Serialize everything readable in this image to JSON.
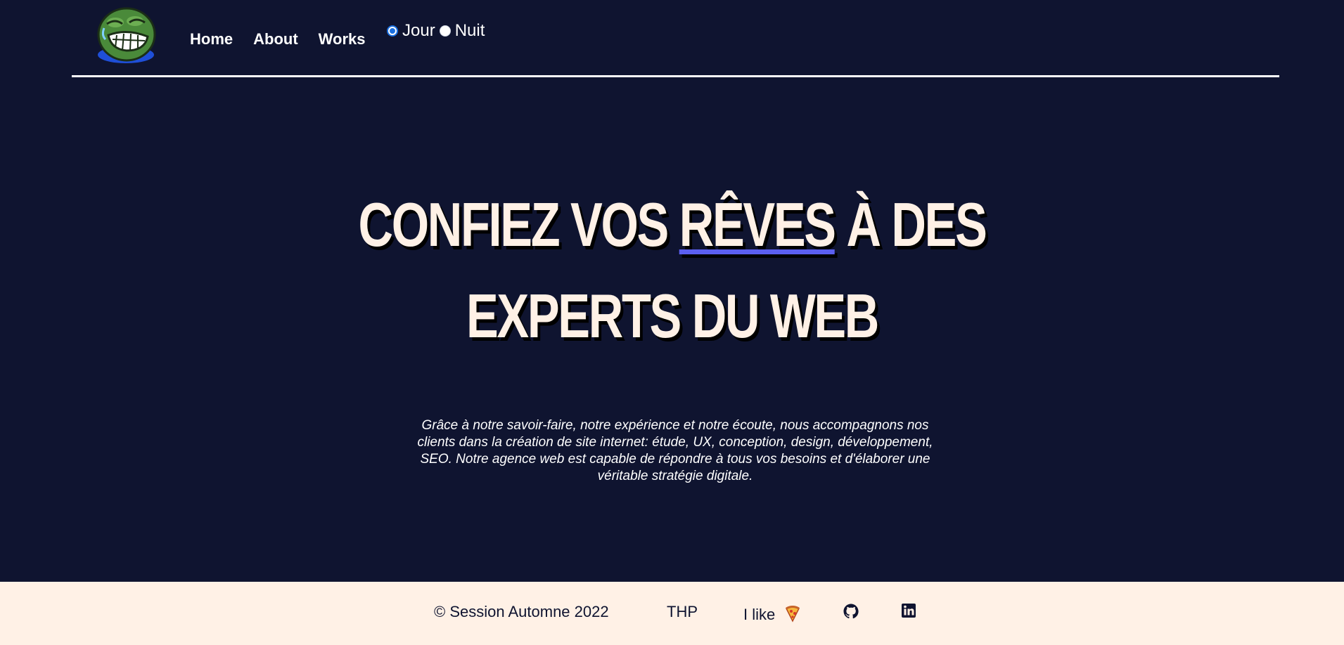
{
  "header": {
    "logo_icon": "pepe-frog-logo-icon",
    "nav": [
      {
        "label": "Home"
      },
      {
        "label": "About"
      },
      {
        "label": "Works"
      }
    ],
    "theme_options": [
      {
        "label": "Jour",
        "checked": true
      },
      {
        "label": "Nuit",
        "checked": false
      }
    ]
  },
  "hero": {
    "part1": "CONFIEZ VOS ",
    "highlight": "RÊVES",
    "part2": " À DES",
    "line2": "EXPERTS DU WEB",
    "highlight_color": "#5b5ff0"
  },
  "description": "Grâce à notre savoir-faire, notre expérience et notre écoute, nous accompagnons nos clients dans la création de site internet: étude, UX, conception, design, développement, SEO. Notre agence web est capable de répondre à tous vos besoins et d'élaborer une véritable stratégie digitale.",
  "footer": {
    "copyright": "© Session Automne 2022",
    "thp": "THP",
    "like": "I like",
    "pizza_icon": "pizza-icon",
    "github_icon": "github-icon",
    "linkedin_icon": "linkedin-icon"
  },
  "colors": {
    "background": "#0f1430",
    "footer_background": "#fff1e6",
    "hero_text": "#fff1e6"
  }
}
